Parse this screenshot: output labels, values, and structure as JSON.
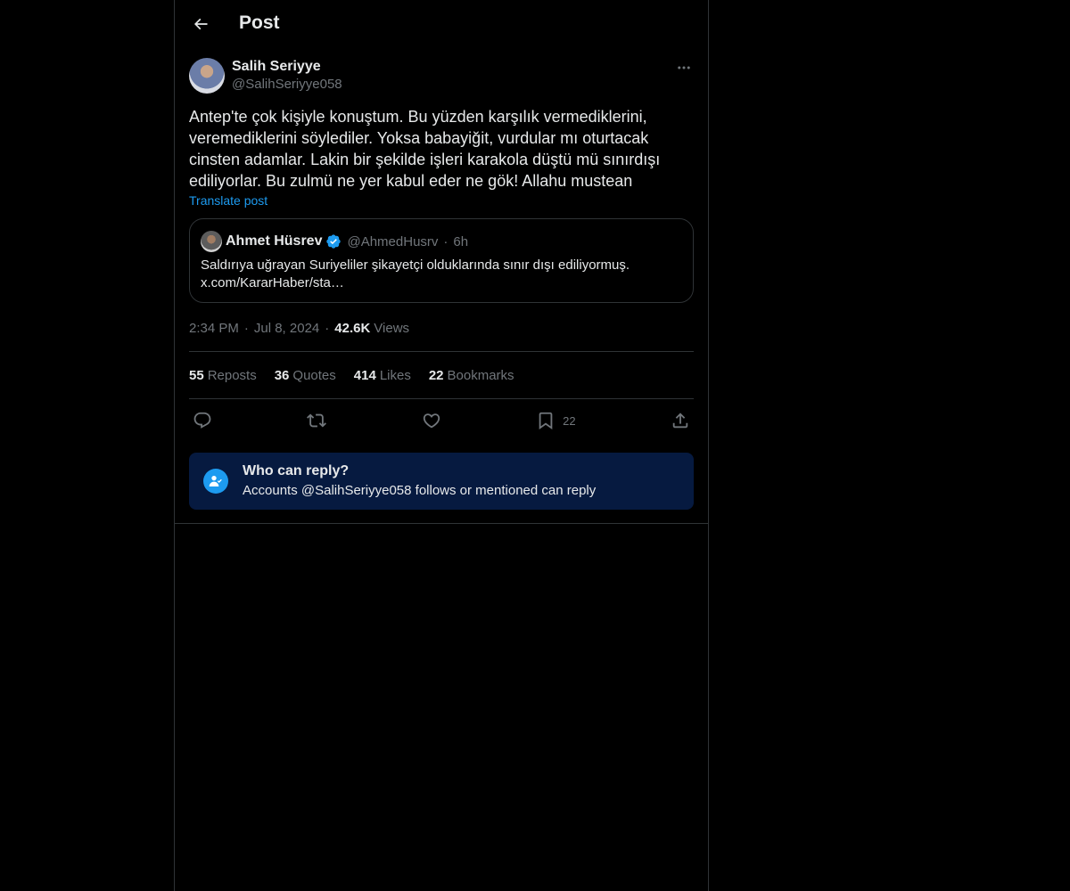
{
  "header": {
    "title": "Post"
  },
  "post": {
    "author": {
      "name": "Salih Seriyye",
      "handle": "@SalihSeriyye058"
    },
    "text": "Antep'te çok kişiyle konuştum. Bu yüzden karşılık vermediklerini, veremediklerini söylediler. Yoksa babayiğit, vurdular mı oturtacak cinsten adamlar. Lakin bir şekilde işleri karakola düştü mü sınırdışı ediliyorlar. Bu zulmü ne yer kabul eder ne gök! Allahu mustean",
    "translate_label": "Translate post",
    "quote": {
      "name": "Ahmet Hüsrev",
      "verified": true,
      "handle": "@AhmedHusrv",
      "dot": "·",
      "time": "6h",
      "text": "Saldırıya uğrayan Suriyeliler şikayetçi olduklarında sınır dışı ediliyormuş. x.com/KararHaber/sta…"
    },
    "meta": {
      "time": "2:34 PM",
      "sep": "·",
      "date": "Jul 8, 2024",
      "views_count": "42.6K",
      "views_label": "Views"
    },
    "stats": [
      {
        "num": "55",
        "label": "Reposts"
      },
      {
        "num": "36",
        "label": "Quotes"
      },
      {
        "num": "414",
        "label": "Likes"
      },
      {
        "num": "22",
        "label": "Bookmarks"
      }
    ],
    "actions": {
      "reply_icon": "reply-icon",
      "repost_icon": "repost-icon",
      "like_icon": "heart-icon",
      "bookmark_icon": "bookmark-icon",
      "bookmark_count": "22",
      "share_icon": "share-icon"
    },
    "reply_restriction": {
      "title": "Who can reply?",
      "subtitle": "Accounts @SalihSeriyye058 follows or mentioned can reply"
    }
  },
  "colors": {
    "background": "#000000",
    "text": "#e7e9ea",
    "muted": "#71767b",
    "accent": "#1d9bf0",
    "border": "#2f3336",
    "reply_box": "#061a40"
  }
}
